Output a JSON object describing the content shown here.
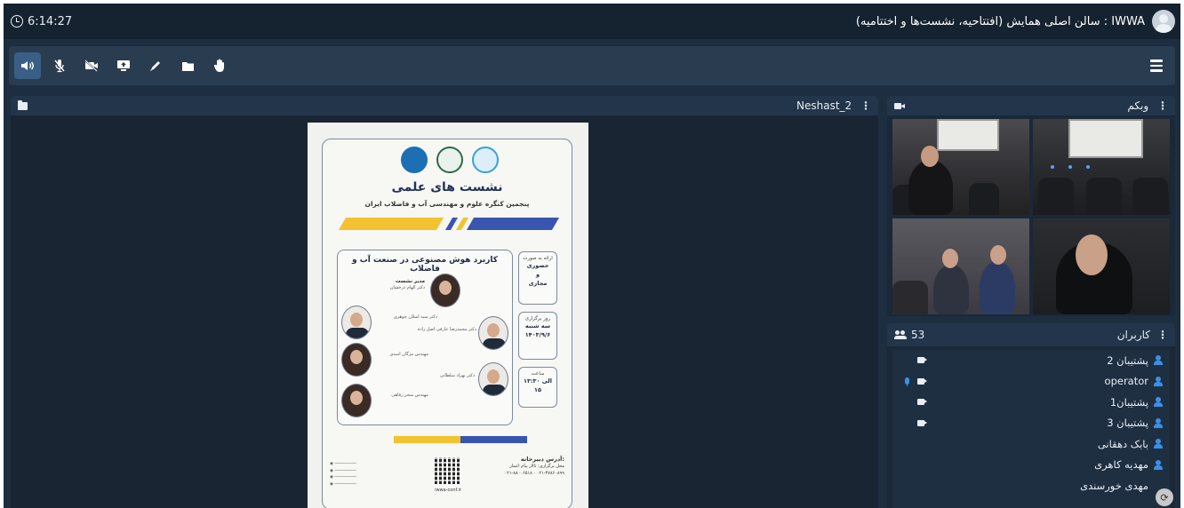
{
  "topbar": {
    "time": "6:14:27",
    "title": "IWWA : سالن اصلی همایش (افتتاحیه، نشست‌ها و اختتامیه)"
  },
  "toolbar": {
    "buttons": [
      {
        "name": "speaker-icon",
        "glyph": "🔈︎",
        "active": true
      },
      {
        "name": "microphone-muted-icon",
        "glyph": "🎙︎",
        "active": false
      },
      {
        "name": "camera-off-icon",
        "glyph": "▶",
        "active": false
      },
      {
        "name": "screen-share-icon",
        "glyph": "⬒",
        "active": false
      },
      {
        "name": "pen-icon",
        "glyph": "✎",
        "active": false
      },
      {
        "name": "folder-icon",
        "glyph": "▰",
        "active": false
      },
      {
        "name": "raise-hand-icon",
        "glyph": "✋",
        "active": false
      }
    ]
  },
  "presentation": {
    "pane_title": "Neshast_2",
    "poster": {
      "title": "نشست های علمی",
      "subtitle": "پنجمین کنگره علوم و مهندسی آب و فاضلاب ایران",
      "topic": "کاربرد هوش مصنوعی در صنعت آب و فاضلاب",
      "mode_label": "ارائه به صورت",
      "mode_value_1": "حضوری",
      "mode_value_2": "و",
      "mode_value_3": "مجازی",
      "day_label": "روز برگزاری",
      "day_value": "سه شنبه",
      "date_value": "۱۴۰۳/۹/۶",
      "time_label": "ساعت",
      "time_value": "۱۳:۳۰ الی ۱۵",
      "moderator_label": "مدیر نشست",
      "moderator_name": "دکتر الهام درخشان",
      "speaker_1": "دکتر سید اسلان چوهری",
      "speaker_2": "دکتر محمدرضا عارفی اصل زاده",
      "speaker_3": "مهندس مژگان اسدی",
      "speaker_4": "دکتر بهزاد سلطانی",
      "speaker_5": "مهندس سحر رفاهی",
      "qr_caption": "iwwa-conf.ir",
      "contact_title": "آدرس دبیرخانه:",
      "venue": "محل برگزاری: تالار پیام اعمار",
      "phone_1": "۰۲۱-۸۸۰۰۶۵۱۸",
      "phone_2": "۰۲۱-۴۷۸۶۰۸۹۹"
    }
  },
  "webcam": {
    "pane_title": "وبکم"
  },
  "users": {
    "pane_title": "کاربران",
    "count": "53",
    "list": [
      {
        "name": "پشتیبان 2",
        "video": true,
        "mic": false
      },
      {
        "name": "operator",
        "video": true,
        "mic": true
      },
      {
        "name": "پشتیبان1",
        "video": true,
        "mic": false
      },
      {
        "name": "پشتیبان 3",
        "video": true,
        "mic": false
      },
      {
        "name": "بابک دهقانی",
        "video": false,
        "mic": false
      },
      {
        "name": "مهدیه کاهری",
        "video": false,
        "mic": false
      },
      {
        "name": "مهدی خورسندی",
        "video": false,
        "mic": false
      }
    ]
  },
  "colors": {
    "background": "#1d2e40",
    "panel_header": "#23354a",
    "accent_blue": "#3b8fe8",
    "active_button": "#3a5f86"
  }
}
